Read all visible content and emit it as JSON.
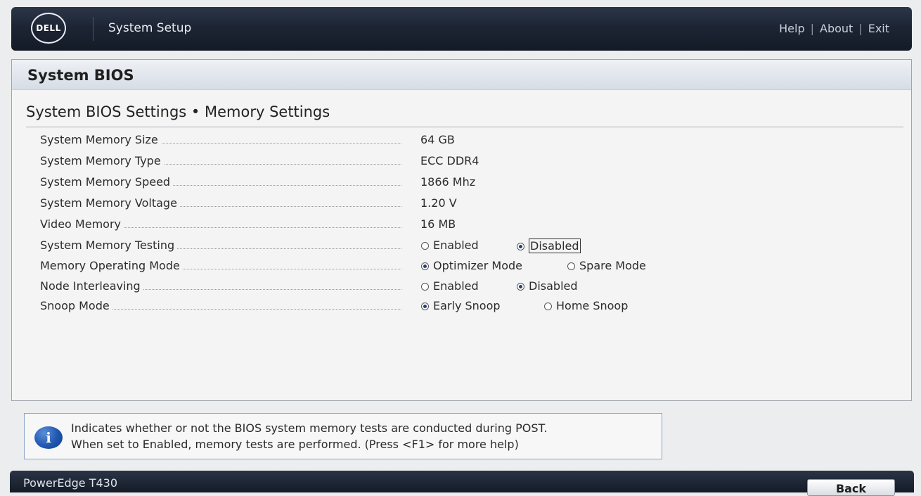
{
  "header": {
    "logo_text": "DELL",
    "app_title": "System Setup",
    "nav": {
      "help": "Help",
      "about": "About",
      "exit": "Exit",
      "separator": "|"
    }
  },
  "main": {
    "title": "System BIOS",
    "subtitle": "System BIOS Settings • Memory Settings",
    "info_rows": [
      {
        "label": "System Memory Size",
        "value": "64 GB"
      },
      {
        "label": "System Memory Type",
        "value": "ECC DDR4"
      },
      {
        "label": "System Memory Speed",
        "value": "1866 Mhz"
      },
      {
        "label": "System Memory Voltage",
        "value": "1.20 V"
      },
      {
        "label": "Video Memory",
        "value": "16 MB"
      }
    ],
    "option_rows": [
      {
        "label": "System Memory Testing",
        "options": [
          "Enabled",
          "Disabled"
        ],
        "selected": "Disabled",
        "focused": true
      },
      {
        "label": "Memory Operating Mode",
        "options": [
          "Optimizer Mode",
          "Spare Mode"
        ],
        "selected": "Optimizer Mode"
      },
      {
        "label": "Node Interleaving",
        "options": [
          "Enabled",
          "Disabled"
        ],
        "selected": "Disabled"
      },
      {
        "label": "Snoop Mode",
        "options": [
          "Early Snoop",
          "Home Snoop"
        ],
        "selected": "Early Snoop"
      }
    ]
  },
  "help": {
    "icon": "info-icon",
    "line1": "Indicates whether or not the BIOS system memory tests are conducted during POST.",
    "line2": "When set to Enabled, memory tests are performed. (Press <F1> for more help)"
  },
  "footer": {
    "model": "PowerEdge T430",
    "back_label": "Back"
  },
  "colors": {
    "header_bg": "#1d2534",
    "radio_selected": "#243d7a",
    "help_border": "#8aa3c4"
  }
}
